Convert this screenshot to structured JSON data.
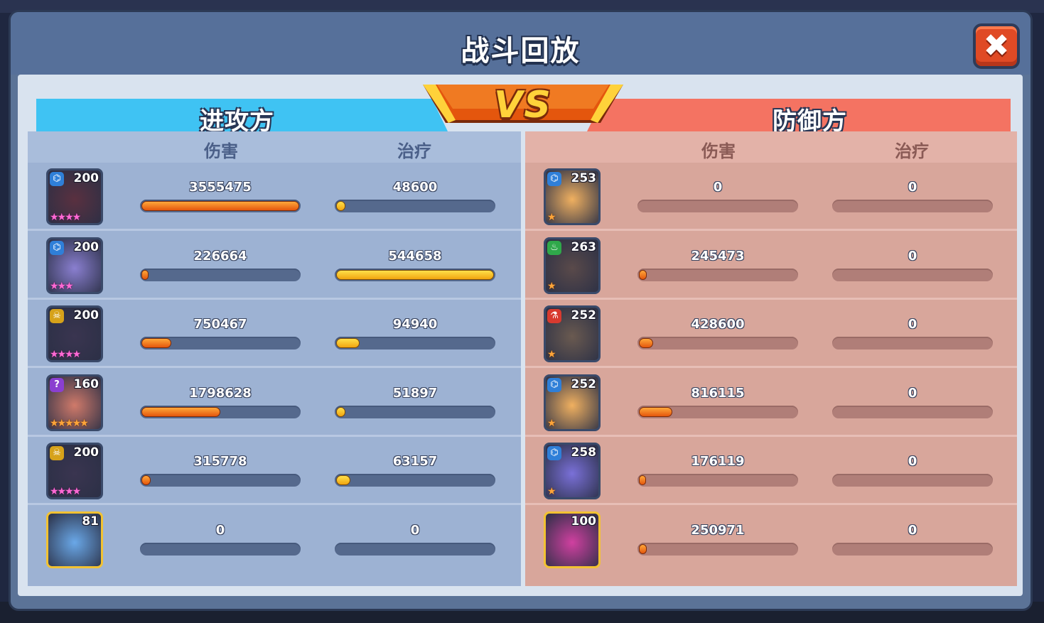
{
  "title": "战斗回放",
  "close_label": "✖",
  "vs_label": "VS",
  "attacker": {
    "header": "进攻方",
    "col_damage": "伤害",
    "col_heal": "治疗",
    "heroes": [
      {
        "level": "200",
        "damage": "3555475",
        "heal": "48600",
        "damage_frac": 1.0,
        "heal_frac": 0.06,
        "class_icon": "dna-icon",
        "stars": "★★★★",
        "star_color": "pink",
        "frame": "normal",
        "portrait_color": "#5a3040"
      },
      {
        "level": "200",
        "damage": "226664",
        "heal": "544658",
        "damage_frac": 0.04,
        "heal_frac": 1.0,
        "class_icon": "dna-icon",
        "stars": "★★★",
        "star_color": "pink",
        "frame": "normal",
        "portrait_color": "#8a7fd0"
      },
      {
        "level": "200",
        "damage": "750467",
        "heal": "94940",
        "damage_frac": 0.19,
        "heal_frac": 0.15,
        "class_icon": "skull-icon",
        "stars": "★★★★",
        "star_color": "pink",
        "frame": "normal",
        "portrait_color": "#3a3550"
      },
      {
        "level": "160",
        "damage": "1798628",
        "heal": "51897",
        "damage_frac": 0.5,
        "heal_frac": 0.06,
        "class_icon": "question-icon",
        "stars": "★★★★★",
        "star_color": "orange",
        "frame": "normal",
        "portrait_color": "#d07a6a"
      },
      {
        "level": "200",
        "damage": "315778",
        "heal": "63157",
        "damage_frac": 0.06,
        "heal_frac": 0.09,
        "class_icon": "skull-icon",
        "stars": "★★★★",
        "star_color": "pink",
        "frame": "normal",
        "portrait_color": "#3a3550"
      },
      {
        "level": "81",
        "damage": "0",
        "heal": "0",
        "damage_frac": 0,
        "heal_frac": 0,
        "class_icon": "",
        "stars": "",
        "star_color": "pink",
        "frame": "gold",
        "portrait_color": "#6aa8e8"
      }
    ]
  },
  "defender": {
    "header": "防御方",
    "col_damage": "伤害",
    "col_heal": "治疗",
    "heroes": [
      {
        "level": "253",
        "damage": "0",
        "heal": "0",
        "damage_frac": 0,
        "heal_frac": 0,
        "class_icon": "dna-icon",
        "stars": "★",
        "star_color": "orange",
        "frame": "normal",
        "portrait_color": "#f0b060"
      },
      {
        "level": "263",
        "damage": "245473",
        "heal": "0",
        "damage_frac": 0.05,
        "heal_frac": 0,
        "class_icon": "potion-icon",
        "stars": "★",
        "star_color": "orange",
        "frame": "normal",
        "portrait_color": "#5a4a4a"
      },
      {
        "level": "252",
        "damage": "428600",
        "heal": "0",
        "damage_frac": 0.09,
        "heal_frac": 0,
        "class_icon": "flask-icon",
        "stars": "★",
        "star_color": "orange",
        "frame": "normal",
        "portrait_color": "#6a5a50"
      },
      {
        "level": "252",
        "damage": "816115",
        "heal": "0",
        "damage_frac": 0.21,
        "heal_frac": 0,
        "class_icon": "dna-icon",
        "stars": "★",
        "star_color": "orange",
        "frame": "normal",
        "portrait_color": "#f0b060"
      },
      {
        "level": "258",
        "damage": "176119",
        "heal": "0",
        "damage_frac": 0.03,
        "heal_frac": 0,
        "class_icon": "dna-icon",
        "stars": "★",
        "star_color": "orange",
        "frame": "normal",
        "portrait_color": "#7a70d8"
      },
      {
        "level": "100",
        "damage": "250971",
        "heal": "0",
        "damage_frac": 0.05,
        "heal_frac": 0,
        "class_icon": "",
        "stars": "",
        "star_color": "orange",
        "frame": "gold",
        "portrait_color": "#d040a0"
      }
    ]
  }
}
